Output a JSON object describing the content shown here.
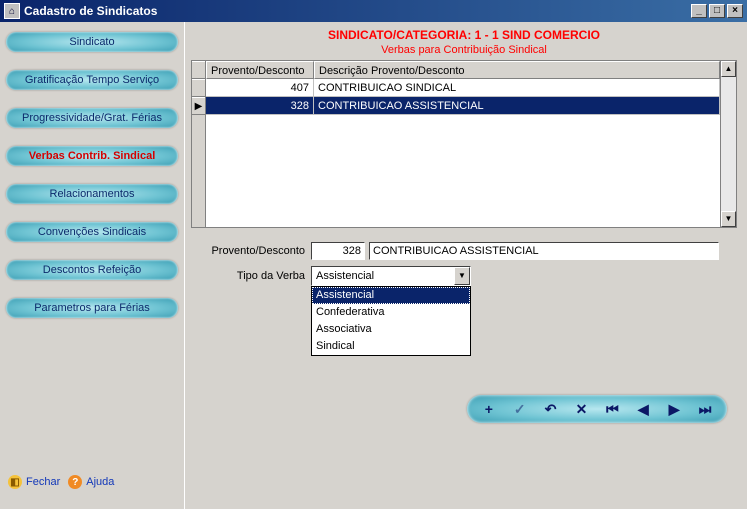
{
  "window": {
    "title": "Cadastro de Sindicatos",
    "min": "_",
    "max": "□",
    "close": "×"
  },
  "sidebar": {
    "items": [
      {
        "label": "Sindicato",
        "active": false
      },
      {
        "label": "Gratificação Tempo Serviço",
        "active": false
      },
      {
        "label": "Progressividade/Grat. Férias",
        "active": false
      },
      {
        "label": "Verbas Contrib. Sindical",
        "active": true
      },
      {
        "label": "Relacionamentos",
        "active": false
      },
      {
        "label": "Convenções Sindicais",
        "active": false
      },
      {
        "label": "Descontos Refeição",
        "active": false
      },
      {
        "label": "Parametros para Férias",
        "active": false
      }
    ],
    "fechar": "Fechar",
    "ajuda": "Ajuda"
  },
  "header": {
    "line1": "SINDICATO/CATEGORIA: 1 - 1 SIND COMERCIO",
    "line2": "Verbas para Contribuição Sindical"
  },
  "grid": {
    "columns": {
      "c1": "Provento/Desconto",
      "c2": "Descrição Provento/Desconto"
    },
    "rows": [
      {
        "c1": "407",
        "c2": "CONTRIBUICAO SINDICAL",
        "selected": false
      },
      {
        "c1": "328",
        "c2": "CONTRIBUICAO ASSISTENCIAL",
        "selected": true
      }
    ]
  },
  "form": {
    "label_provdesc": "Provento/Desconto",
    "code": "328",
    "desc": "CONTRIBUICAO ASSISTENCIAL",
    "label_tipo": "Tipo da Verba",
    "tipo_value": "Assistencial",
    "options": [
      {
        "label": "Assistencial",
        "selected": true
      },
      {
        "label": "Confederativa",
        "selected": false
      },
      {
        "label": "Associativa",
        "selected": false
      },
      {
        "label": "Sindical",
        "selected": false
      }
    ]
  },
  "navbar": {
    "add": "+",
    "ok": "✓",
    "undo": "↶",
    "del": "✕",
    "first": "⏮",
    "prev": "◀",
    "next": "▶",
    "last": "⏭"
  },
  "scroll": {
    "up": "▲",
    "down": "▼"
  }
}
